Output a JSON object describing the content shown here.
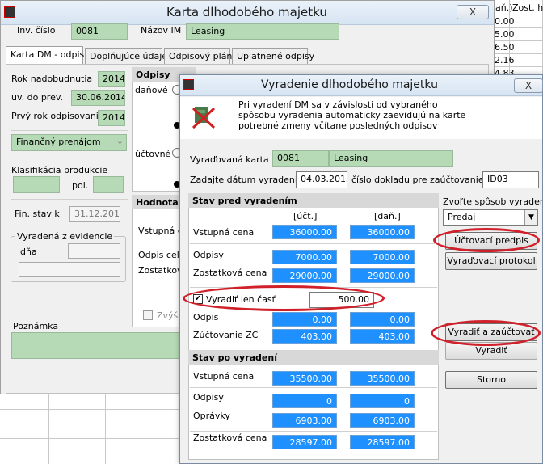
{
  "background_grid": {
    "header": "Zost. ho",
    "col_label": "daň.)",
    "values": [
      "0.00",
      "5.00",
      "6.50",
      "2.16",
      "4.83",
      "1.60"
    ]
  },
  "main_window": {
    "title": "Karta dlhodobého majetku",
    "close_label": "X",
    "inv_label": "Inv. číslo",
    "inv_value": "0081",
    "name_label": "Názov IM",
    "name_value": "Leasing",
    "tabs": [
      "Karta DM - odpisy",
      "Doplňujúce údaje",
      "Odpisový plán",
      "Uplatnené odpisy"
    ],
    "rok_nadob_label": "Rok nadobudnutia",
    "rok_nadob_value": "2014",
    "uv_label": "uv. do prev.",
    "uv_value": "30.06.2014",
    "prvy_rok_label": "Prvý rok odpisovania",
    "prvy_rok_value": "2014",
    "financny": "Finančný prenájom",
    "klasif_label": "Klasifikácia produkcie",
    "pol_label": "pol.",
    "fin_stav_label": "Fin. stav k",
    "fin_stav_value": "31.12.2014",
    "vyradena_label": "Vyradená z evidencie",
    "dna_label": "dňa",
    "poznamka_label": "Poznámka",
    "odpisy_head": "Odpisy",
    "danove_label": "daňové",
    "uctovne_label": "účtovné",
    "hodnota_head": "Hodnota",
    "vstupna_label": "Vstupná ce",
    "odpis_celk_label": "Odpis celko",
    "zostatk_label": "Zostatková",
    "zvys_label": "Zvýše"
  },
  "dialog": {
    "title": "Vyradenie dlhodobého majetku",
    "close_label": "X",
    "info": [
      "Pri vyradení DM sa v závislosti od vybraného",
      "spôsobu vyradenia automaticky zaevidujú na karte",
      "potrebné zmeny včítane posledných odpisov"
    ],
    "vyradovana_label": "Vyraďovaná karta",
    "card_no": "0081",
    "card_name": "Leasing",
    "date_label": "Zadajte dátum vyradenia",
    "date_value": "04.03.2015",
    "doc_label": "číslo dokladu pre zaúčtovanie",
    "doc_value": "ID03",
    "stav_pred": "Stav pred vyradením",
    "col_uct": "[účt.]",
    "col_dan": "[daň.]",
    "rows_pred": [
      {
        "label": "Vstupná cena",
        "uct": "36000.00",
        "dan": "36000.00"
      },
      {
        "label": "Odpisy",
        "uct": "7000.00",
        "dan": "7000.00"
      },
      {
        "label": "Zostatková cena",
        "uct": "29000.00",
        "dan": "29000.00"
      }
    ],
    "vyradit_cast_label": "Vyradiť len časť",
    "vyradit_cast_value": "500.00",
    "rows_mid": [
      {
        "label": "Odpis",
        "uct": "0.00",
        "dan": "0.00"
      },
      {
        "label": "Zúčtovanie ZC",
        "uct": "403.00",
        "dan": "403.00"
      }
    ],
    "stav_po": "Stav po vyradení",
    "rows_po": [
      {
        "label": "Vstupná cena",
        "uct": "35500.00",
        "dan": "35500.00"
      },
      {
        "label": "Odpisy",
        "uct": "0",
        "dan": "0"
      },
      {
        "label": "Oprávky",
        "uct": "6903.00",
        "dan": "6903.00"
      },
      {
        "label": "Zostatková cena",
        "uct": "28597.00",
        "dan": "28597.00"
      }
    ],
    "sposob_label": "Zvoľte spôsob vyradenia",
    "sposob_value": "Predaj",
    "btn_uct_predpis": "Účtovací predpis",
    "btn_protokol": "Vyraďovací protokol",
    "btn_vyradit_zauct": "Vyradiť a zaúčtovať",
    "btn_vyradit": "Vyradiť",
    "btn_storno": "Storno"
  },
  "colors": {
    "accent_blue": "#1e90ff",
    "field_green": "#b6dab6",
    "highlight_red": "#d0202a"
  }
}
